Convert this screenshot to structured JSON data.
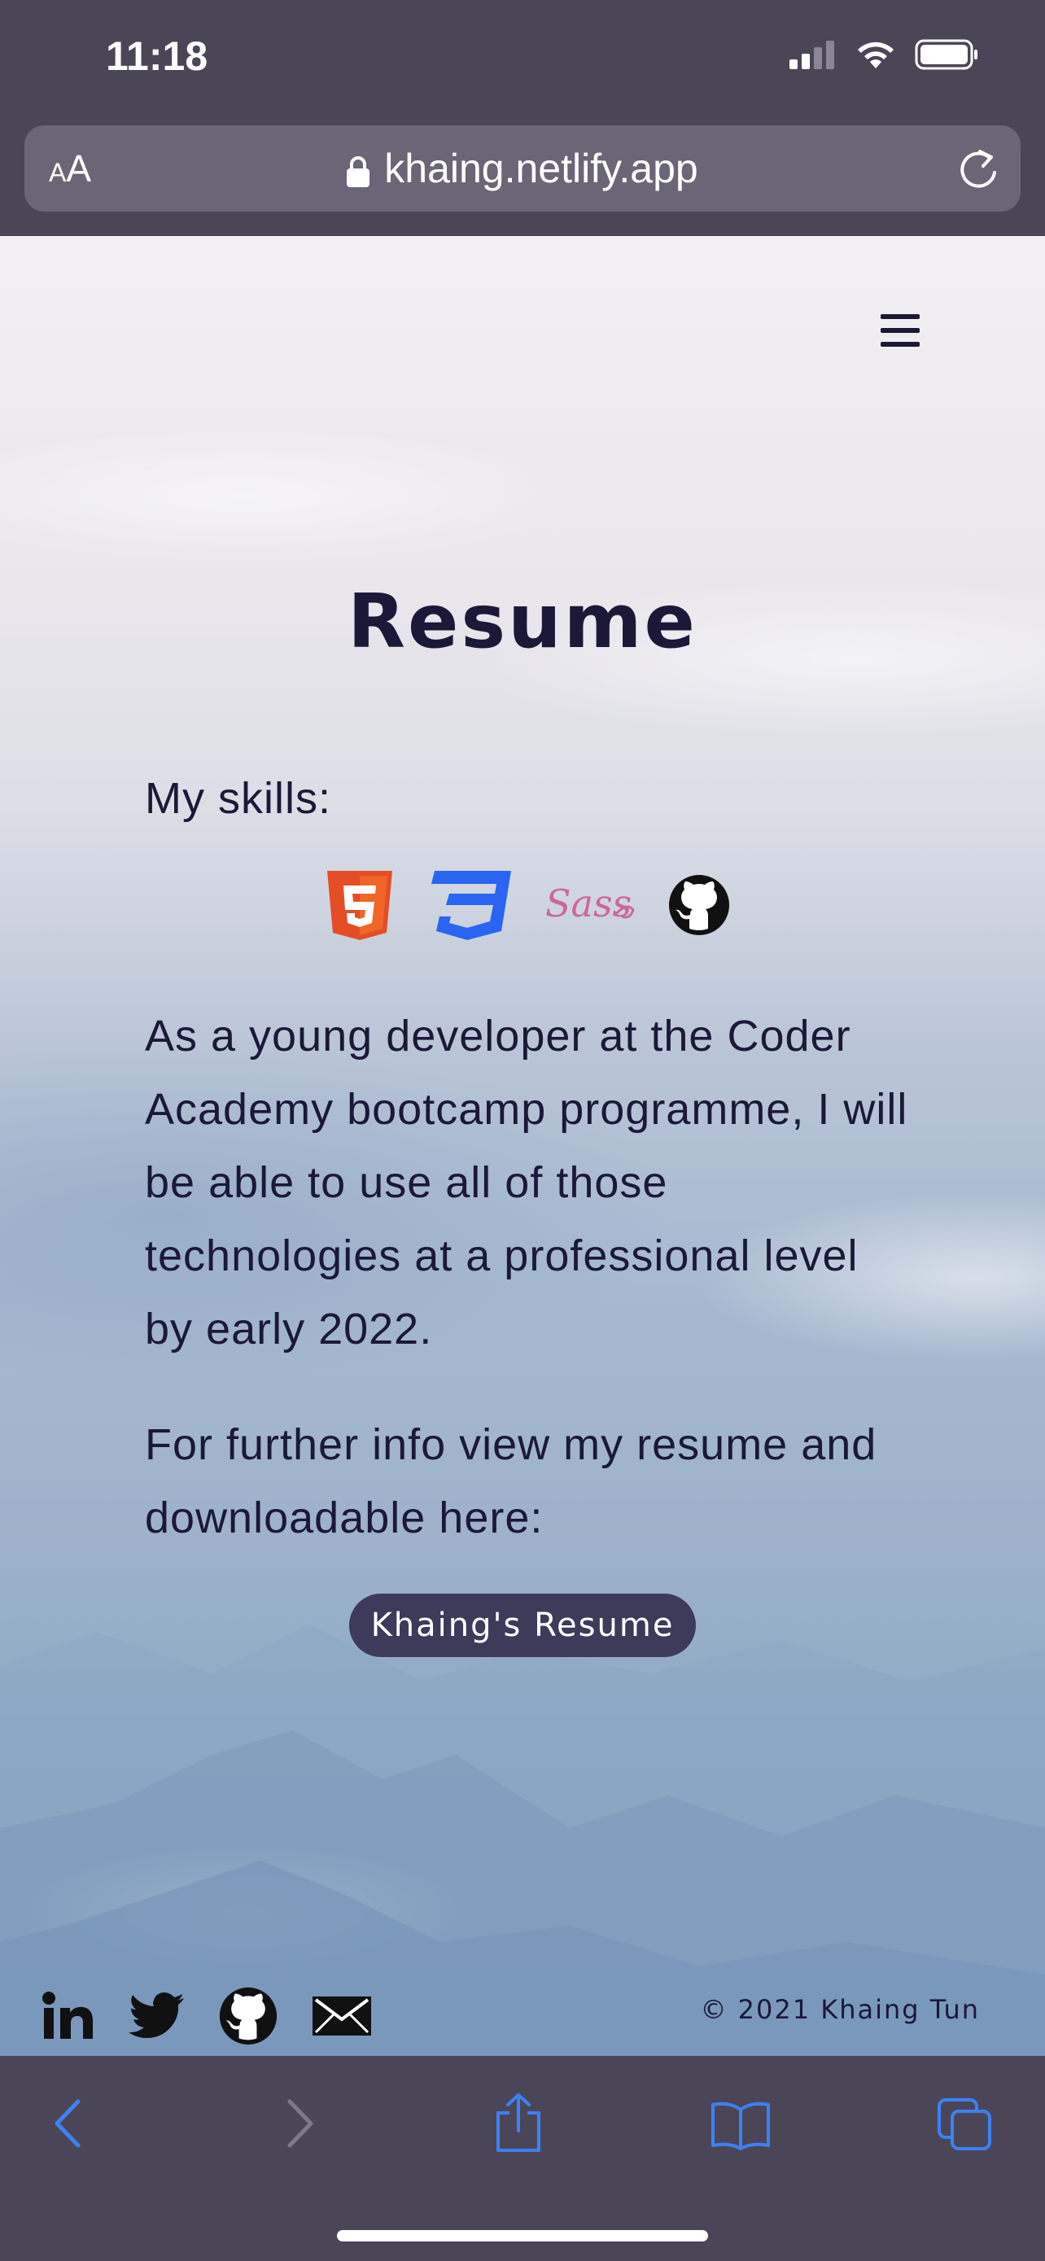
{
  "status_bar": {
    "time": "11:18"
  },
  "browser": {
    "text_size_small": "A",
    "text_size_large": "A",
    "url": "khaing.netlify.app"
  },
  "page": {
    "title": "Resume",
    "skills_label": "My skills:",
    "skills": [
      "html5-icon",
      "css3-icon",
      "sass-icon",
      "github-icon"
    ],
    "paragraph1": "As a young developer at the Coder Academy bootcamp programme, I will be able to use all of those technologies at a professional level by early 2022.",
    "paragraph2": "For further info view my resume and downloadable here:",
    "resume_button": "Khaing's Resume",
    "copyright": "© 2021 Khaing Tun",
    "social_icons": [
      "linkedin-icon",
      "twitter-icon",
      "github-icon",
      "mail-icon"
    ]
  },
  "colors": {
    "chrome_bg": "#4a4658",
    "text_dark": "#1b1838",
    "button_bg": "#3d3a5a",
    "ios_blue": "#3b82f6"
  }
}
